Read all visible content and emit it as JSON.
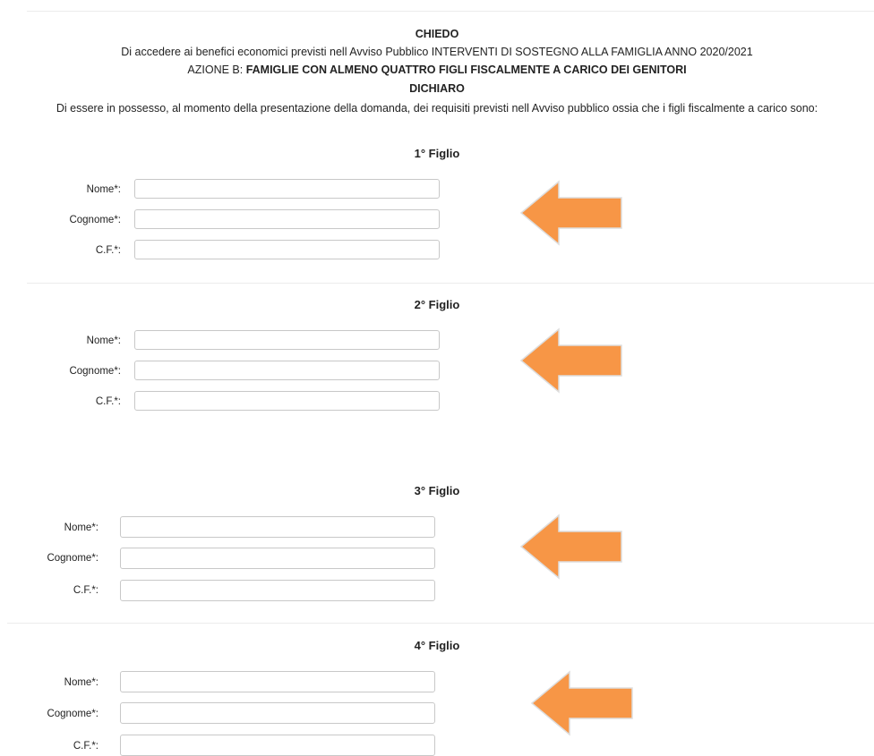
{
  "intro": {
    "chiedo": "CHIEDO",
    "line1": "Di accedere ai benefici economici previsti nell Avviso Pubblico INTERVENTI DI SOSTEGNO ALLA FAMIGLIA ANNO 2020/2021",
    "line2_prefix": "AZIONE B: ",
    "line2_bold": "FAMIGLIE CON ALMENO QUATTRO FIGLI FISCALMENTE A CARICO DEI GENITORI",
    "dichiaro": "DICHIARO",
    "line3": "Di essere in possesso, al momento della presentazione della domanda, dei requisiti previsti nell Avviso pubblico ossia che i figli fiscalmente a carico sono:"
  },
  "figli": [
    {
      "title": "1° Figlio",
      "nome_label": "Nome*:",
      "cognome_label": "Cognome*:",
      "cf_label": "C.F.*:",
      "nome": "",
      "cognome": "",
      "cf": ""
    },
    {
      "title": "2° Figlio",
      "nome_label": "Nome*:",
      "cognome_label": "Cognome*:",
      "cf_label": "C.F.*:",
      "nome": "",
      "cognome": "",
      "cf": ""
    },
    {
      "title": "3° Figlio",
      "nome_label": "Nome*:",
      "cognome_label": "Cognome*:",
      "cf_label": "C.F.*:",
      "nome": "",
      "cognome": "",
      "cf": ""
    },
    {
      "title": "4° Figlio",
      "nome_label": "Nome*:",
      "cognome_label": "Cognome*:",
      "cf_label": "C.F.*:",
      "nome": "",
      "cognome": "",
      "cf": ""
    }
  ],
  "colors": {
    "arrow_fill": "#f79646",
    "divider": "#ececec",
    "input_border": "#c8c8c8"
  }
}
